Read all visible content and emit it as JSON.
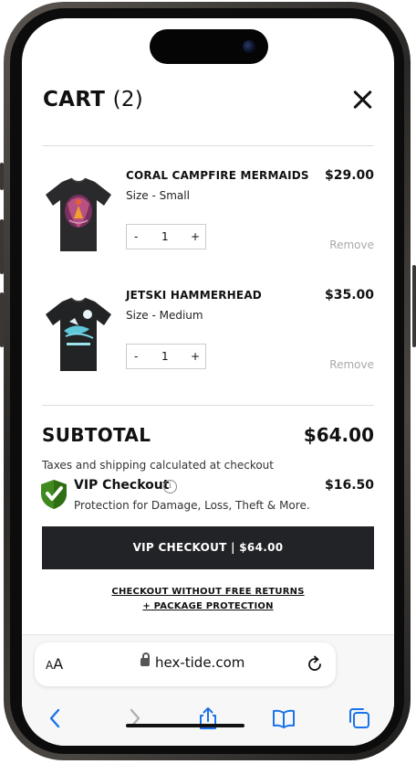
{
  "cart": {
    "title": "CART",
    "count": "(2)"
  },
  "items": [
    {
      "name": "CORAL CAMPFIRE MERMAIDS",
      "size": "Size - Small",
      "price": "$29.00",
      "qty": "1",
      "minus": "-",
      "plus": "+",
      "remove": "Remove"
    },
    {
      "name": "JETSKI HAMMERHEAD",
      "size": "Size - Medium",
      "price": "$35.00",
      "qty": "1",
      "minus": "-",
      "plus": "+",
      "remove": "Remove"
    }
  ],
  "summary": {
    "subtotal_label": "SUBTOTAL",
    "subtotal_value": "$64.00",
    "tax_note": "Taxes and shipping calculated at checkout"
  },
  "vip": {
    "title": "VIP Checkout",
    "info": "i",
    "price": "$16.50",
    "desc": "Protection for Damage, Loss, Theft & More."
  },
  "checkout": {
    "button": "VIP CHECKOUT | $64.00",
    "alt_line1": "CHECKOUT WITHOUT FREE RETURNS",
    "alt_line2": "+ PACKAGE PROTECTION"
  },
  "browser": {
    "aa_small": "A",
    "aa_large": "A",
    "url": "hex-tide.com",
    "toolbar": [
      "back-icon",
      "forward-icon",
      "share-icon",
      "bookmarks-icon",
      "tabs-icon"
    ]
  },
  "colors": {
    "accent": "#222326",
    "shield": "#3f8a1e",
    "muted": "#aaaaaa",
    "link_blue": "#1a73e8"
  }
}
